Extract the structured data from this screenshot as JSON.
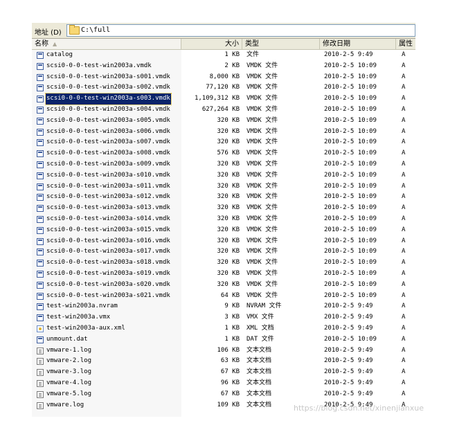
{
  "address_bar": {
    "label": "地址 (D)",
    "path": "C:\\full"
  },
  "columns": {
    "name": "名称",
    "size": "大小",
    "type": "类型",
    "date": "修改日期",
    "attr": "属性"
  },
  "files": [
    {
      "name": "catalog",
      "size": "1 KB",
      "type": "文件",
      "date": "2010-2-5 9:49",
      "attr": "A",
      "icon": "file-icon"
    },
    {
      "name": "scsi0-0-0-test-win2003a.vmdk",
      "size": "2 KB",
      "type": "VMDK 文件",
      "date": "2010-2-5 10:09",
      "attr": "A",
      "icon": "disk-icon"
    },
    {
      "name": "scsi0-0-0-test-win2003a-s001.vmdk",
      "size": "8,000 KB",
      "type": "VMDK 文件",
      "date": "2010-2-5 10:09",
      "attr": "A",
      "icon": "disk-icon"
    },
    {
      "name": "scsi0-0-0-test-win2003a-s002.vmdk",
      "size": "77,120 KB",
      "type": "VMDK 文件",
      "date": "2010-2-5 10:09",
      "attr": "A",
      "icon": "disk-icon"
    },
    {
      "name": "scsi0-0-0-test-win2003a-s003.vmdk",
      "size": "1,109,312 KB",
      "type": "VMDK 文件",
      "date": "2010-2-5 10:09",
      "attr": "A",
      "icon": "disk-icon",
      "selected": true
    },
    {
      "name": "scsi0-0-0-test-win2003a-s004.vmdk",
      "size": "627,264 KB",
      "type": "VMDK 文件",
      "date": "2010-2-5 10:09",
      "attr": "A",
      "icon": "disk-icon"
    },
    {
      "name": "scsi0-0-0-test-win2003a-s005.vmdk",
      "size": "320 KB",
      "type": "VMDK 文件",
      "date": "2010-2-5 10:09",
      "attr": "A",
      "icon": "disk-icon"
    },
    {
      "name": "scsi0-0-0-test-win2003a-s006.vmdk",
      "size": "320 KB",
      "type": "VMDK 文件",
      "date": "2010-2-5 10:09",
      "attr": "A",
      "icon": "disk-icon"
    },
    {
      "name": "scsi0-0-0-test-win2003a-s007.vmdk",
      "size": "320 KB",
      "type": "VMDK 文件",
      "date": "2010-2-5 10:09",
      "attr": "A",
      "icon": "disk-icon"
    },
    {
      "name": "scsi0-0-0-test-win2003a-s008.vmdk",
      "size": "576 KB",
      "type": "VMDK 文件",
      "date": "2010-2-5 10:09",
      "attr": "A",
      "icon": "disk-icon"
    },
    {
      "name": "scsi0-0-0-test-win2003a-s009.vmdk",
      "size": "320 KB",
      "type": "VMDK 文件",
      "date": "2010-2-5 10:09",
      "attr": "A",
      "icon": "disk-icon"
    },
    {
      "name": "scsi0-0-0-test-win2003a-s010.vmdk",
      "size": "320 KB",
      "type": "VMDK 文件",
      "date": "2010-2-5 10:09",
      "attr": "A",
      "icon": "disk-icon"
    },
    {
      "name": "scsi0-0-0-test-win2003a-s011.vmdk",
      "size": "320 KB",
      "type": "VMDK 文件",
      "date": "2010-2-5 10:09",
      "attr": "A",
      "icon": "disk-icon"
    },
    {
      "name": "scsi0-0-0-test-win2003a-s012.vmdk",
      "size": "320 KB",
      "type": "VMDK 文件",
      "date": "2010-2-5 10:09",
      "attr": "A",
      "icon": "disk-icon"
    },
    {
      "name": "scsi0-0-0-test-win2003a-s013.vmdk",
      "size": "320 KB",
      "type": "VMDK 文件",
      "date": "2010-2-5 10:09",
      "attr": "A",
      "icon": "disk-icon"
    },
    {
      "name": "scsi0-0-0-test-win2003a-s014.vmdk",
      "size": "320 KB",
      "type": "VMDK 文件",
      "date": "2010-2-5 10:09",
      "attr": "A",
      "icon": "disk-icon"
    },
    {
      "name": "scsi0-0-0-test-win2003a-s015.vmdk",
      "size": "320 KB",
      "type": "VMDK 文件",
      "date": "2010-2-5 10:09",
      "attr": "A",
      "icon": "disk-icon"
    },
    {
      "name": "scsi0-0-0-test-win2003a-s016.vmdk",
      "size": "320 KB",
      "type": "VMDK 文件",
      "date": "2010-2-5 10:09",
      "attr": "A",
      "icon": "disk-icon"
    },
    {
      "name": "scsi0-0-0-test-win2003a-s017.vmdk",
      "size": "320 KB",
      "type": "VMDK 文件",
      "date": "2010-2-5 10:09",
      "attr": "A",
      "icon": "disk-icon"
    },
    {
      "name": "scsi0-0-0-test-win2003a-s018.vmdk",
      "size": "320 KB",
      "type": "VMDK 文件",
      "date": "2010-2-5 10:09",
      "attr": "A",
      "icon": "disk-icon"
    },
    {
      "name": "scsi0-0-0-test-win2003a-s019.vmdk",
      "size": "320 KB",
      "type": "VMDK 文件",
      "date": "2010-2-5 10:09",
      "attr": "A",
      "icon": "disk-icon"
    },
    {
      "name": "scsi0-0-0-test-win2003a-s020.vmdk",
      "size": "320 KB",
      "type": "VMDK 文件",
      "date": "2010-2-5 10:09",
      "attr": "A",
      "icon": "disk-icon"
    },
    {
      "name": "scsi0-0-0-test-win2003a-s021.vmdk",
      "size": "64 KB",
      "type": "VMDK 文件",
      "date": "2010-2-5 10:09",
      "attr": "A",
      "icon": "disk-icon"
    },
    {
      "name": "test-win2003a.nvram",
      "size": "9 KB",
      "type": "NVRAM 文件",
      "date": "2010-2-5 9:49",
      "attr": "A",
      "icon": "disk-icon"
    },
    {
      "name": "test-win2003a.vmx",
      "size": "3 KB",
      "type": "VMX 文件",
      "date": "2010-2-5 9:49",
      "attr": "A",
      "icon": "disk-icon"
    },
    {
      "name": "test-win2003a-aux.xml",
      "size": "1 KB",
      "type": "XML 文档",
      "date": "2010-2-5 9:49",
      "attr": "A",
      "icon": "xml-icon"
    },
    {
      "name": "unmount.dat",
      "size": "1 KB",
      "type": "DAT 文件",
      "date": "2010-2-5 10:09",
      "attr": "A",
      "icon": "disk-icon"
    },
    {
      "name": "vmware-1.log",
      "size": "106 KB",
      "type": "文本文档",
      "date": "2010-2-5 9:49",
      "attr": "A",
      "icon": "text-file-icon"
    },
    {
      "name": "vmware-2.log",
      "size": "63 KB",
      "type": "文本文档",
      "date": "2010-2-5 9:49",
      "attr": "A",
      "icon": "text-file-icon"
    },
    {
      "name": "vmware-3.log",
      "size": "67 KB",
      "type": "文本文档",
      "date": "2010-2-5 9:49",
      "attr": "A",
      "icon": "text-file-icon"
    },
    {
      "name": "vmware-4.log",
      "size": "96 KB",
      "type": "文本文档",
      "date": "2010-2-5 9:49",
      "attr": "A",
      "icon": "text-file-icon"
    },
    {
      "name": "vmware-5.log",
      "size": "67 KB",
      "type": "文本文档",
      "date": "2010-2-5 9:49",
      "attr": "A",
      "icon": "text-file-icon"
    },
    {
      "name": "vmware.log",
      "size": "109 KB",
      "type": "文本文档",
      "date": "2010-2-5 9:49",
      "attr": "A",
      "icon": "text-file-icon"
    }
  ],
  "watermark": "https://blog.csdn.net/xinenjianxue"
}
